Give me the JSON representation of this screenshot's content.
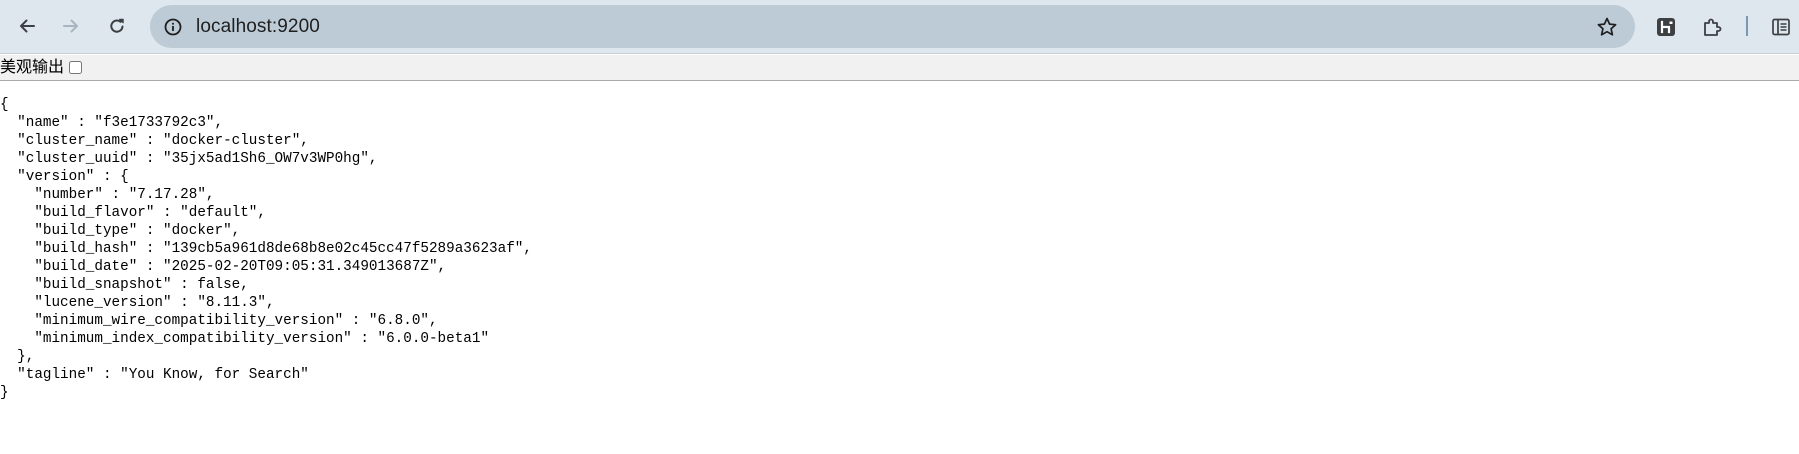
{
  "browser": {
    "address": "localhost:9200",
    "icons": {
      "back": "arrow-left-icon",
      "forward": "arrow-right-icon",
      "reload": "reload-icon",
      "site_info": "info-circle-icon",
      "bookmark": "star-icon",
      "extension_1": "h-logo-icon",
      "extension_2": "puzzle-piece-icon",
      "side_panel": "side-panel-icon"
    },
    "colors": {
      "toolbar_bg": "#dfe7ee",
      "omnibox_bg": "#bccbd6",
      "icon": "#3c4043",
      "icon_disabled": "#a7b4bf"
    }
  },
  "viewer": {
    "pretty_print_label": "美观输出",
    "pretty_print_checked": false
  },
  "json_lines": [
    "{",
    "  \"name\" : \"f3e1733792c3\",",
    "  \"cluster_name\" : \"docker-cluster\",",
    "  \"cluster_uuid\" : \"35jx5ad1Sh6_OW7v3WP0hg\",",
    "  \"version\" : {",
    "    \"number\" : \"7.17.28\",",
    "    \"build_flavor\" : \"default\",",
    "    \"build_type\" : \"docker\",",
    "    \"build_hash\" : \"139cb5a961d8de68b8e02c45cc47f5289a3623af\",",
    "    \"build_date\" : \"2025-02-20T09:05:31.349013687Z\",",
    "    \"build_snapshot\" : false,",
    "    \"lucene_version\" : \"8.11.3\",",
    "    \"minimum_wire_compatibility_version\" : \"6.8.0\",",
    "    \"minimum_index_compatibility_version\" : \"6.0.0-beta1\"",
    "  },",
    "  \"tagline\" : \"You Know, for Search\"",
    "}"
  ]
}
